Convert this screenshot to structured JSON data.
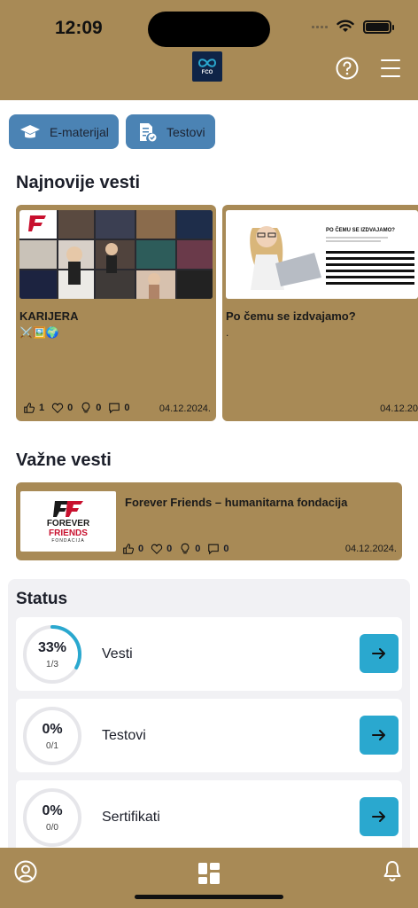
{
  "status_bar": {
    "time": "12:09"
  },
  "header": {
    "logo_text": "FCO"
  },
  "chips": [
    {
      "label": "E-materijal",
      "icon": "graduation-cap-icon"
    },
    {
      "label": "Testovi",
      "icon": "test-document-icon"
    }
  ],
  "latest_news": {
    "title": "Najnovije vesti",
    "items": [
      {
        "title": "KARIJERA",
        "subtitle": "⚔️🖼️🌍",
        "likes": "1",
        "hearts": "0",
        "ideas": "0",
        "comments": "0",
        "date": "04.12.2024."
      },
      {
        "title": "Po čemu se izdvajamo?",
        "subtitle": ".",
        "likes": "",
        "hearts": "",
        "ideas": "",
        "comments": "",
        "date": "04.12.20"
      }
    ]
  },
  "important_news": {
    "title": "Važne vesti",
    "item": {
      "title": "Forever Friends – humanitarna fondacija",
      "logo_line1": "FOREVER",
      "logo_line2": "FRIENDS",
      "logo_line3": "FONDACIJA",
      "likes": "0",
      "hearts": "0",
      "ideas": "0",
      "comments": "0",
      "date": "04.12.2024."
    }
  },
  "status": {
    "title": "Status",
    "rows": [
      {
        "label": "Vesti",
        "percent": "33%",
        "count": "1/3",
        "progress": 0.33
      },
      {
        "label": "Testovi",
        "percent": "0%",
        "count": "0/1",
        "progress": 0
      },
      {
        "label": "Sertifikati",
        "percent": "0%",
        "count": "0/0",
        "progress": 0
      }
    ]
  },
  "colors": {
    "brand": "#a88a56",
    "chip": "#4b83b4",
    "accent": "#2aa8cf"
  }
}
